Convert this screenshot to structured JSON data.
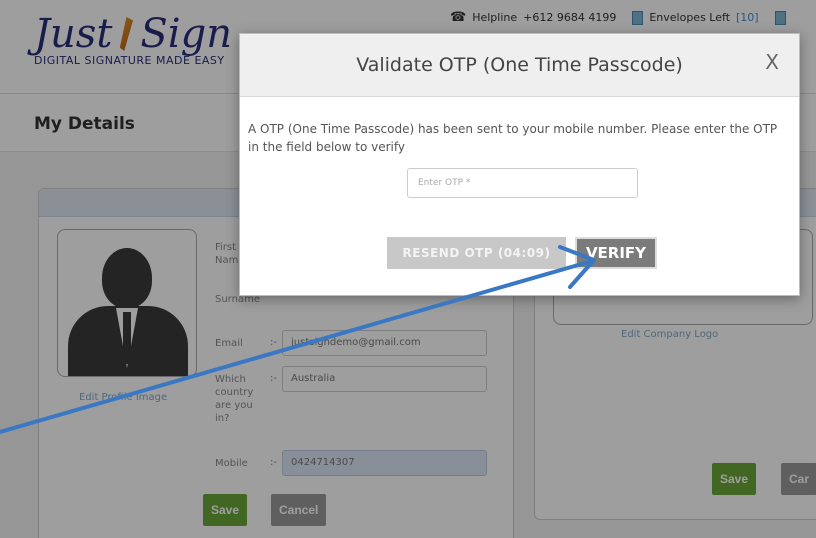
{
  "header": {
    "logo_word_1": "Just",
    "logo_word_2": "Sign",
    "logo_tagline": "DIGITAL SIGNATURE MADE EASY",
    "helpline_label": "Helpline",
    "helpline_number": "+612 9684 4199",
    "envelopes_label": "Envelopes Left",
    "envelopes_count": "[10]",
    "accent_color": "#2a2f7a"
  },
  "page": {
    "title": "My Details"
  },
  "profile": {
    "first_name_label": "First Name",
    "surname_label": "Surname",
    "email_label": "Email",
    "email_value": "justsigndemo@gmail.com",
    "country_label": "Which country are you in?",
    "country_value": "Australia",
    "mobile_label": "Mobile",
    "mobile_value": "0424714307",
    "separator": ":-",
    "edit_image_link": "Edit Profile Image",
    "save_label": "Save",
    "cancel_label": "Cancel"
  },
  "company": {
    "edit_logo_link": "Edit Company Logo",
    "save_label": "Save",
    "cancel_label": "Car"
  },
  "modal": {
    "title": "Validate OTP (One Time Passcode)",
    "close_label": "X",
    "message": "A OTP (One Time Passcode) has been sent to your mobile number. Please enter the OTP in the field below to verify",
    "otp_placeholder": "Enter OTP *",
    "resend_label": "RESEND OTP (04:09)",
    "verify_label": "VERIFY"
  },
  "annotation": {
    "arrow_color": "#3a78c4"
  }
}
